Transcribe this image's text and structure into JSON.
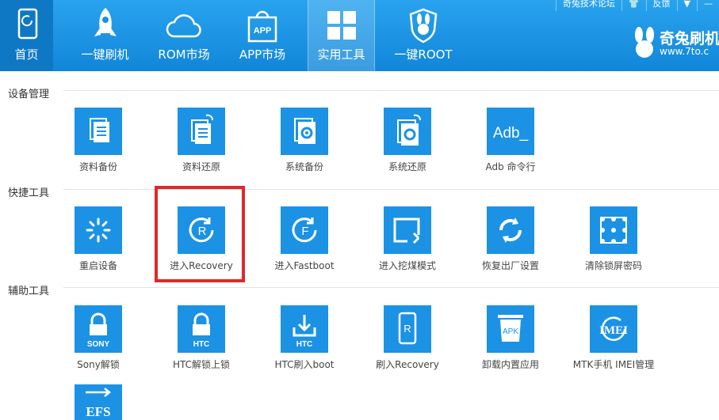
{
  "nav": {
    "home": "首页",
    "flash": "一键刷机",
    "rom": "ROM市场",
    "app": "APP市场",
    "tools": "实用工具",
    "root": "一键ROOT",
    "app_icon_text": "APP"
  },
  "toplinks": {
    "forum": "奇兔技术论坛",
    "feedback": "反馈"
  },
  "brand": {
    "name": "奇兔刷机",
    "url": "www.7to.c"
  },
  "sections": {
    "device": "设备管理",
    "quick": "快捷工具",
    "assist": "辅助工具"
  },
  "tools": {
    "backup_data": "资料备份",
    "restore_data": "资料还原",
    "backup_sys": "系统备份",
    "restore_sys": "系统还原",
    "adb": "Adb 命令行",
    "adb_icon": "Adb_",
    "reboot": "重启设备",
    "recovery": "进入Recovery",
    "fastboot": "进入Fastboot",
    "mining": "进入挖煤模式",
    "factory": "恢复出厂设置",
    "clear_lock": "清除锁屏密码",
    "sony": "Sony解锁",
    "sony_icon": "SONY",
    "htc_unlock": "HTC解锁上锁",
    "htc_icon": "HTC",
    "htc_boot": "HTC刷入boot",
    "htc_boot_icon": "HTC",
    "flash_rec": "刷入Recovery",
    "uninstall": "卸载内置应用",
    "apk_icon": "APK",
    "mtk": "MTK手机 IMEI管理",
    "imei_icon": "IMEI",
    "efs_icon": "EFS"
  },
  "colors": {
    "topbar": "#1a92e2",
    "tile": "#1b92e4",
    "highlight": "#e0282a"
  }
}
